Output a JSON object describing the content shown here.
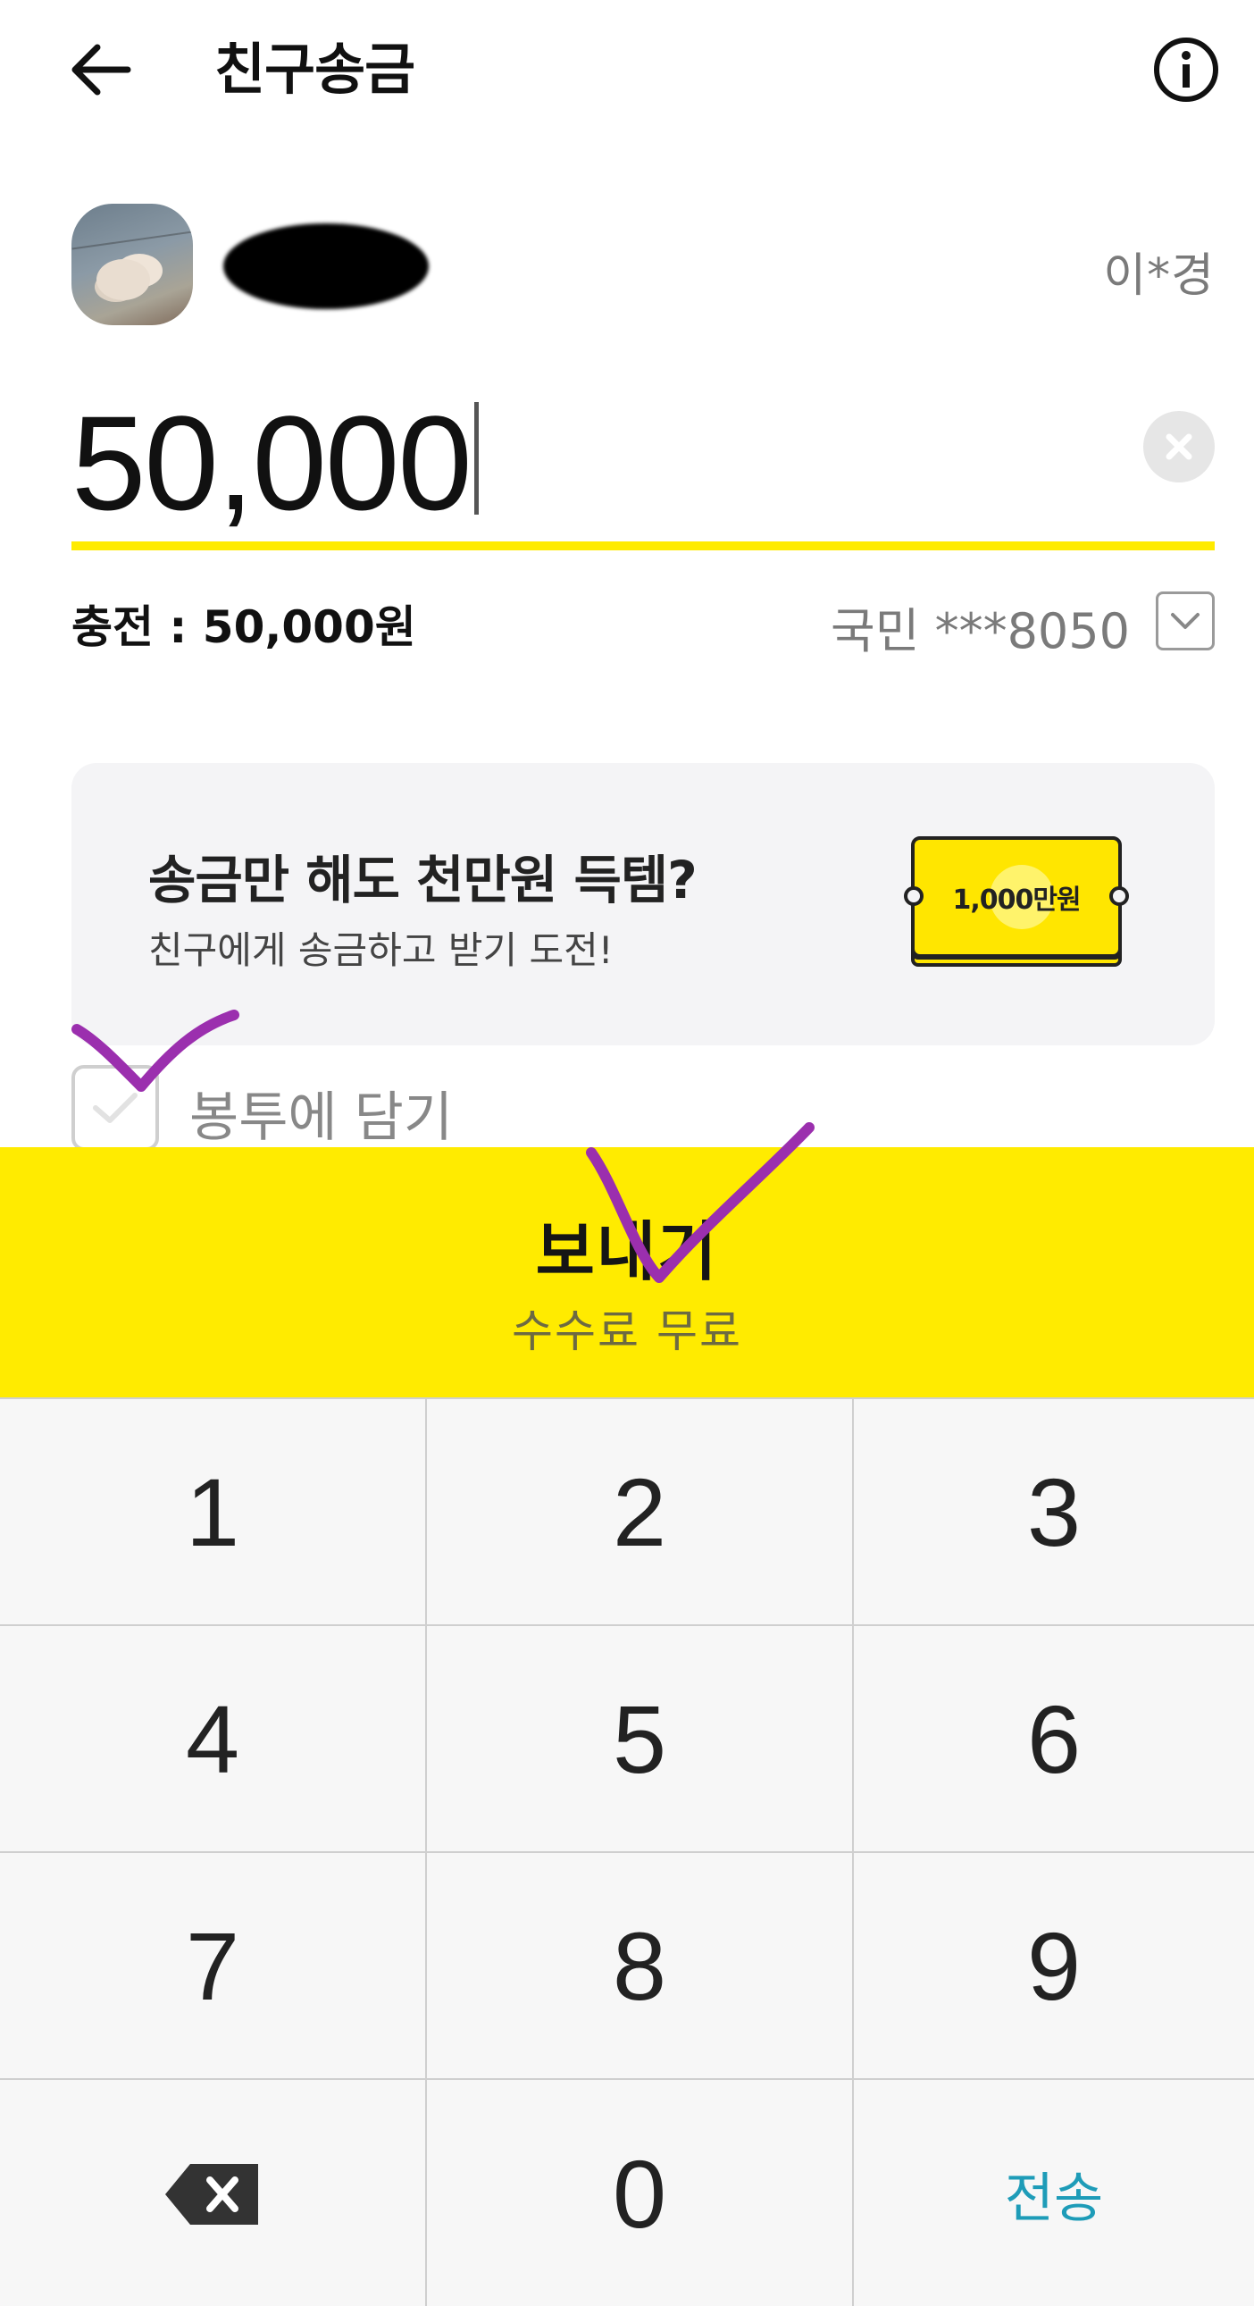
{
  "header": {
    "title": "친구송금",
    "back_icon": "arrow-left-icon",
    "info_icon": "info-circle-icon"
  },
  "recipient": {
    "name": "이*경"
  },
  "amount": {
    "value": "50,000"
  },
  "charge": {
    "label": "충전 : 50,000원",
    "account": "국민 ***8050"
  },
  "promo": {
    "title": "송금만 해도 천만원 득템?",
    "subtitle": "친구에게 송금하고 받기 도전!",
    "ticket_text": "1,000만원"
  },
  "envelope": {
    "label": "봉투에 담기",
    "checked": false
  },
  "send": {
    "label": "보내기",
    "sub": "수수료 무료"
  },
  "keypad": {
    "keys": [
      "1",
      "2",
      "3",
      "4",
      "5",
      "6",
      "7",
      "8",
      "9",
      "",
      "0",
      "전송"
    ],
    "delete_icon": "backspace-icon"
  },
  "colors": {
    "accent": "#ffeb00",
    "send_key": "#1e9cb8",
    "annotation": "#9b2fae"
  }
}
